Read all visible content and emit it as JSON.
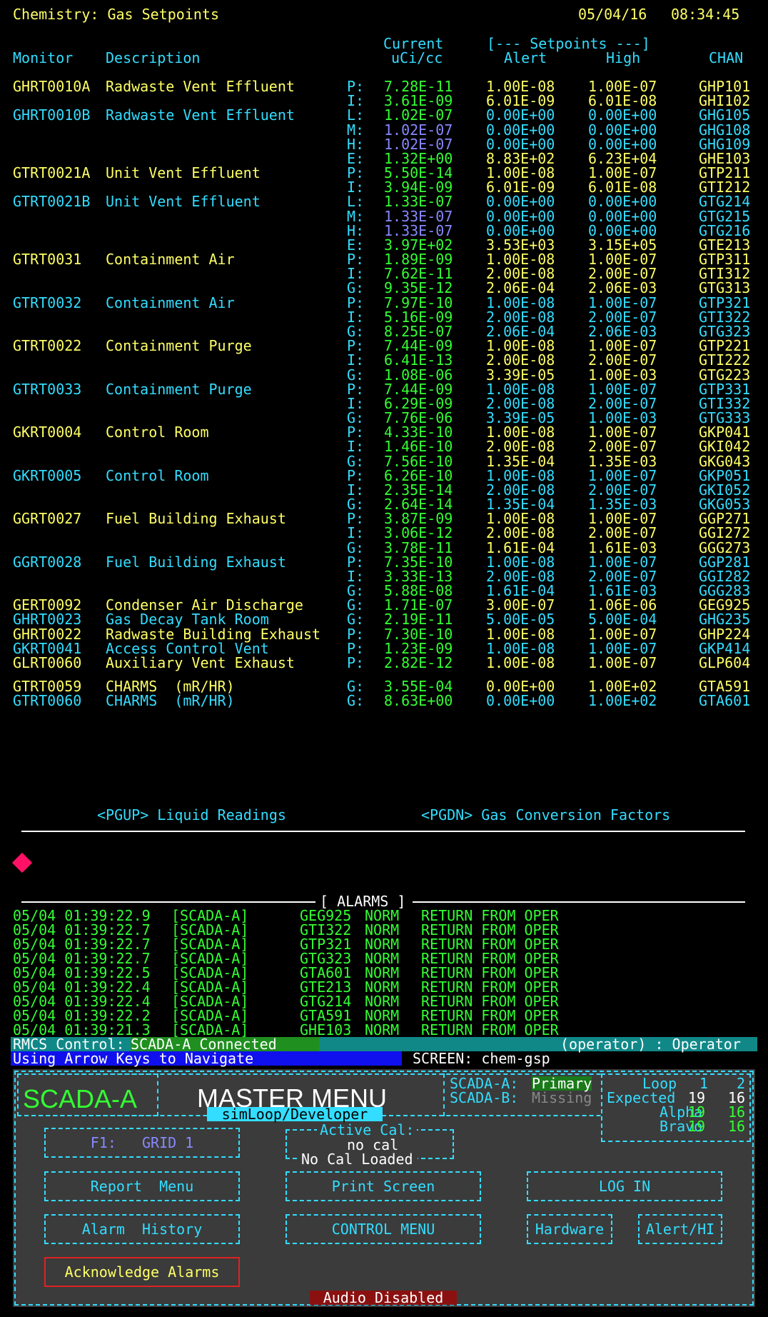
{
  "header": {
    "title": "Chemistry: Gas Setpoints",
    "date": "05/04/16",
    "time": "08:34:45"
  },
  "columns": {
    "current_top": "Current",
    "current_unit": "uCi/cc",
    "setpoints_group": "[--- Setpoints ---]",
    "monitor": "Monitor",
    "description": "Description",
    "alert": "Alert",
    "high": "High",
    "chan": "CHAN"
  },
  "rows": [
    {
      "monitor": "GHRT0010A",
      "desc": "Radwaste Vent Effluent",
      "t": "P:",
      "cur": "7.28E-11",
      "alert": "1.00E-08",
      "high": "1.00E-07",
      "chan": "GHP101",
      "mc": "y",
      "vc": "g",
      "sc": "y"
    },
    {
      "monitor": "",
      "desc": "",
      "t": "I:",
      "cur": "3.61E-09",
      "alert": "6.01E-09",
      "high": "6.01E-08",
      "chan": "GHI102",
      "mc": "y",
      "vc": "g",
      "sc": "y"
    },
    {
      "monitor": "GHRT0010B",
      "desc": "Radwaste Vent Effluent",
      "t": "L:",
      "cur": "1.02E-07",
      "alert": "0.00E+00",
      "high": "0.00E+00",
      "chan": "GHG105",
      "mc": "c",
      "vc": "g",
      "sc": "c"
    },
    {
      "monitor": "",
      "desc": "",
      "t": "M:",
      "cur": "1.02E-07",
      "alert": "0.00E+00",
      "high": "0.00E+00",
      "chan": "GHG108",
      "mc": "c",
      "vc": "b",
      "sc": "c"
    },
    {
      "monitor": "",
      "desc": "",
      "t": "H:",
      "cur": "1.02E-07",
      "alert": "0.00E+00",
      "high": "0.00E+00",
      "chan": "GHG109",
      "mc": "c",
      "vc": "b",
      "sc": "c"
    },
    {
      "monitor": "",
      "desc": "",
      "t": "E:",
      "cur": "1.32E+00",
      "alert": "8.83E+02",
      "high": "6.23E+04",
      "chan": "GHE103",
      "mc": "c",
      "vc": "g",
      "sc": "y"
    },
    {
      "monitor": "GTRT0021A",
      "desc": "Unit Vent Effluent",
      "t": "P:",
      "cur": "5.50E-14",
      "alert": "1.00E-08",
      "high": "1.00E-07",
      "chan": "GTP211",
      "mc": "y",
      "vc": "g",
      "sc": "y"
    },
    {
      "monitor": "",
      "desc": "",
      "t": "I:",
      "cur": "3.94E-09",
      "alert": "6.01E-09",
      "high": "6.01E-08",
      "chan": "GTI212",
      "mc": "y",
      "vc": "g",
      "sc": "y"
    },
    {
      "monitor": "GTRT0021B",
      "desc": "Unit Vent Effluent",
      "t": "L:",
      "cur": "1.33E-07",
      "alert": "0.00E+00",
      "high": "0.00E+00",
      "chan": "GTG214",
      "mc": "c",
      "vc": "g",
      "sc": "c"
    },
    {
      "monitor": "",
      "desc": "",
      "t": "M:",
      "cur": "1.33E-07",
      "alert": "0.00E+00",
      "high": "0.00E+00",
      "chan": "GTG215",
      "mc": "c",
      "vc": "b",
      "sc": "c"
    },
    {
      "monitor": "",
      "desc": "",
      "t": "H:",
      "cur": "1.33E-07",
      "alert": "0.00E+00",
      "high": "0.00E+00",
      "chan": "GTG216",
      "mc": "c",
      "vc": "b",
      "sc": "c"
    },
    {
      "monitor": "",
      "desc": "",
      "t": "E:",
      "cur": "3.97E+02",
      "alert": "3.53E+03",
      "high": "3.15E+05",
      "chan": "GTE213",
      "mc": "c",
      "vc": "g",
      "sc": "y"
    },
    {
      "monitor": "GTRT0031",
      "desc": "Containment Air",
      "t": "P:",
      "cur": "1.89E-09",
      "alert": "1.00E-08",
      "high": "1.00E-07",
      "chan": "GTP311",
      "mc": "y",
      "vc": "g",
      "sc": "y"
    },
    {
      "monitor": "",
      "desc": "",
      "t": "I:",
      "cur": "7.62E-11",
      "alert": "2.00E-08",
      "high": "2.00E-07",
      "chan": "GTI312",
      "mc": "y",
      "vc": "g",
      "sc": "y"
    },
    {
      "monitor": "",
      "desc": "",
      "t": "G:",
      "cur": "9.35E-12",
      "alert": "2.06E-04",
      "high": "2.06E-03",
      "chan": "GTG313",
      "mc": "y",
      "vc": "g",
      "sc": "y"
    },
    {
      "monitor": "GTRT0032",
      "desc": "Containment Air",
      "t": "P:",
      "cur": "7.97E-10",
      "alert": "1.00E-08",
      "high": "1.00E-07",
      "chan": "GTP321",
      "mc": "c",
      "vc": "g",
      "sc": "c"
    },
    {
      "monitor": "",
      "desc": "",
      "t": "I:",
      "cur": "5.16E-09",
      "alert": "2.00E-08",
      "high": "2.00E-07",
      "chan": "GTI322",
      "mc": "c",
      "vc": "g",
      "sc": "c"
    },
    {
      "monitor": "",
      "desc": "",
      "t": "G:",
      "cur": "8.25E-07",
      "alert": "2.06E-04",
      "high": "2.06E-03",
      "chan": "GTG323",
      "mc": "c",
      "vc": "g",
      "sc": "c"
    },
    {
      "monitor": "GTRT0022",
      "desc": "Containment Purge",
      "t": "P:",
      "cur": "7.44E-09",
      "alert": "1.00E-08",
      "high": "1.00E-07",
      "chan": "GTP221",
      "mc": "y",
      "vc": "g",
      "sc": "y"
    },
    {
      "monitor": "",
      "desc": "",
      "t": "I:",
      "cur": "6.41E-13",
      "alert": "2.00E-08",
      "high": "2.00E-07",
      "chan": "GTI222",
      "mc": "y",
      "vc": "g",
      "sc": "y"
    },
    {
      "monitor": "",
      "desc": "",
      "t": "G:",
      "cur": "1.08E-06",
      "alert": "3.39E-05",
      "high": "1.00E-03",
      "chan": "GTG223",
      "mc": "y",
      "vc": "g",
      "sc": "y"
    },
    {
      "monitor": "GTRT0033",
      "desc": "Containment Purge",
      "t": "P:",
      "cur": "7.44E-09",
      "alert": "1.00E-08",
      "high": "1.00E-07",
      "chan": "GTP331",
      "mc": "c",
      "vc": "g",
      "sc": "c"
    },
    {
      "monitor": "",
      "desc": "",
      "t": "I:",
      "cur": "6.29E-09",
      "alert": "2.00E-08",
      "high": "2.00E-07",
      "chan": "GTI332",
      "mc": "c",
      "vc": "g",
      "sc": "c"
    },
    {
      "monitor": "",
      "desc": "",
      "t": "G:",
      "cur": "7.76E-06",
      "alert": "3.39E-05",
      "high": "1.00E-03",
      "chan": "GTG333",
      "mc": "c",
      "vc": "g",
      "sc": "c"
    },
    {
      "monitor": "GKRT0004",
      "desc": "Control Room",
      "t": "P:",
      "cur": "4.33E-10",
      "alert": "1.00E-08",
      "high": "1.00E-07",
      "chan": "GKP041",
      "mc": "y",
      "vc": "g",
      "sc": "y"
    },
    {
      "monitor": "",
      "desc": "",
      "t": "I:",
      "cur": "1.46E-10",
      "alert": "2.00E-08",
      "high": "2.00E-07",
      "chan": "GKI042",
      "mc": "y",
      "vc": "g",
      "sc": "y"
    },
    {
      "monitor": "",
      "desc": "",
      "t": "G:",
      "cur": "7.56E-10",
      "alert": "1.35E-04",
      "high": "1.35E-03",
      "chan": "GKG043",
      "mc": "y",
      "vc": "g",
      "sc": "y"
    },
    {
      "monitor": "GKRT0005",
      "desc": "Control Room",
      "t": "P:",
      "cur": "6.26E-10",
      "alert": "1.00E-08",
      "high": "1.00E-07",
      "chan": "GKP051",
      "mc": "c",
      "vc": "g",
      "sc": "c"
    },
    {
      "monitor": "",
      "desc": "",
      "t": "I:",
      "cur": "2.35E-14",
      "alert": "2.00E-08",
      "high": "2.00E-07",
      "chan": "GKI052",
      "mc": "c",
      "vc": "g",
      "sc": "c"
    },
    {
      "monitor": "",
      "desc": "",
      "t": "G:",
      "cur": "2.64E-14",
      "alert": "1.35E-04",
      "high": "1.35E-03",
      "chan": "GKG053",
      "mc": "c",
      "vc": "g",
      "sc": "c"
    },
    {
      "monitor": "GGRT0027",
      "desc": "Fuel Building Exhaust",
      "t": "P:",
      "cur": "3.87E-09",
      "alert": "1.00E-08",
      "high": "1.00E-07",
      "chan": "GGP271",
      "mc": "y",
      "vc": "g",
      "sc": "y"
    },
    {
      "monitor": "",
      "desc": "",
      "t": "I:",
      "cur": "3.06E-12",
      "alert": "2.00E-08",
      "high": "2.00E-07",
      "chan": "GGI272",
      "mc": "y",
      "vc": "g",
      "sc": "y"
    },
    {
      "monitor": "",
      "desc": "",
      "t": "G:",
      "cur": "3.78E-11",
      "alert": "1.61E-04",
      "high": "1.61E-03",
      "chan": "GGG273",
      "mc": "y",
      "vc": "g",
      "sc": "y"
    },
    {
      "monitor": "GGRT0028",
      "desc": "Fuel Building Exhaust",
      "t": "P:",
      "cur": "7.35E-10",
      "alert": "1.00E-08",
      "high": "1.00E-07",
      "chan": "GGP281",
      "mc": "c",
      "vc": "g",
      "sc": "c"
    },
    {
      "monitor": "",
      "desc": "",
      "t": "I:",
      "cur": "3.33E-13",
      "alert": "2.00E-08",
      "high": "2.00E-07",
      "chan": "GGI282",
      "mc": "c",
      "vc": "g",
      "sc": "c"
    },
    {
      "monitor": "",
      "desc": "",
      "t": "G:",
      "cur": "5.88E-08",
      "alert": "1.61E-04",
      "high": "1.61E-03",
      "chan": "GGG283",
      "mc": "c",
      "vc": "g",
      "sc": "c"
    },
    {
      "monitor": "GERT0092",
      "desc": "Condenser Air Discharge",
      "t": "G:",
      "cur": "1.71E-07",
      "alert": "3.00E-07",
      "high": "1.06E-06",
      "chan": "GEG925",
      "mc": "y",
      "vc": "g",
      "sc": "y"
    },
    {
      "monitor": "GHRT0023",
      "desc": "Gas Decay Tank Room",
      "t": "G:",
      "cur": "2.19E-11",
      "alert": "5.00E-05",
      "high": "5.00E-04",
      "chan": "GHG235",
      "mc": "c",
      "vc": "g",
      "sc": "c"
    },
    {
      "monitor": "GHRT0022",
      "desc": "Radwaste Building Exhaust",
      "t": "P:",
      "cur": "7.30E-10",
      "alert": "1.00E-08",
      "high": "1.00E-07",
      "chan": "GHP224",
      "mc": "y",
      "vc": "g",
      "sc": "y"
    },
    {
      "monitor": "GKRT0041",
      "desc": "Access Control Vent",
      "t": "P:",
      "cur": "1.23E-09",
      "alert": "1.00E-08",
      "high": "1.00E-07",
      "chan": "GKP414",
      "mc": "c",
      "vc": "g",
      "sc": "c"
    },
    {
      "monitor": "GLRT0060",
      "desc": "Auxiliary Vent Exhaust",
      "t": "P:",
      "cur": "2.82E-12",
      "alert": "1.00E-08",
      "high": "1.00E-07",
      "chan": "GLP604",
      "mc": "y",
      "vc": "g",
      "sc": "y"
    }
  ],
  "charms_rows": [
    {
      "monitor": "GTRT0059",
      "desc": "CHARMS  (mR/HR)",
      "t": "G:",
      "cur": "3.55E-04",
      "alert": "0.00E+00",
      "high": "1.00E+02",
      "chan": "GTA591",
      "mc": "y",
      "vc": "g",
      "sc": "y"
    },
    {
      "monitor": "GTRT0060",
      "desc": "CHARMS  (mR/HR)",
      "t": "G:",
      "cur": "8.63E+00",
      "alert": "0.00E+00",
      "high": "1.00E+02",
      "chan": "GTA601",
      "mc": "c",
      "vc": "g",
      "sc": "c"
    }
  ],
  "nav": {
    "pgup": "<PGUP> Liquid Readings",
    "pgdn": "<PGDN> Gas Conversion Factors"
  },
  "alarms_title": "[ ALARMS ]",
  "alarms": [
    {
      "ts": "05/04 01:39:22.9",
      "src": "[SCADA-A]",
      "chan": "GEG925",
      "state": "NORM",
      "msg": "RETURN FROM OPER"
    },
    {
      "ts": "05/04 01:39:22.7",
      "src": "[SCADA-A]",
      "chan": "GTI322",
      "state": "NORM",
      "msg": "RETURN FROM OPER"
    },
    {
      "ts": "05/04 01:39:22.7",
      "src": "[SCADA-A]",
      "chan": "GTP321",
      "state": "NORM",
      "msg": "RETURN FROM OPER"
    },
    {
      "ts": "05/04 01:39:22.7",
      "src": "[SCADA-A]",
      "chan": "GTG323",
      "state": "NORM",
      "msg": "RETURN FROM OPER"
    },
    {
      "ts": "05/04 01:39:22.5",
      "src": "[SCADA-A]",
      "chan": "GTA601",
      "state": "NORM",
      "msg": "RETURN FROM OPER"
    },
    {
      "ts": "05/04 01:39:22.4",
      "src": "[SCADA-A]",
      "chan": "GTE213",
      "state": "NORM",
      "msg": "RETURN FROM OPER"
    },
    {
      "ts": "05/04 01:39:22.4",
      "src": "[SCADA-A]",
      "chan": "GTG214",
      "state": "NORM",
      "msg": "RETURN FROM OPER"
    },
    {
      "ts": "05/04 01:39:22.2",
      "src": "[SCADA-A]",
      "chan": "GTA591",
      "state": "NORM",
      "msg": "RETURN FROM OPER"
    },
    {
      "ts": "05/04 01:39:21.3",
      "src": "[SCADA-A]",
      "chan": "GHE103",
      "state": "NORM",
      "msg": "RETURN FROM OPER"
    }
  ],
  "status": {
    "rmcs_label": "RMCS Control:",
    "rmcs_value": "SCADA-A Connected",
    "operator": "(operator) : Operator",
    "hint": "Using Arrow Keys to Navigate",
    "screen": "SCREEN: chem-gsp"
  },
  "menu": {
    "system": "SCADA-A",
    "title": "MASTER MENU",
    "subtitle": "simLoop/Developer",
    "scada_a_label": "SCADA-A:",
    "scada_a_value": "Primary",
    "scada_b_label": "SCADA-B:",
    "scada_b_value": "Missing",
    "loop_label": "Loop",
    "loop_1": "1",
    "loop_2": "2",
    "expected_label": "Expected",
    "expected_1": "19",
    "expected_2": "16",
    "alpha_label": "Alpha",
    "alpha_1": "19",
    "alpha_2": "16",
    "bravo_label": "Bravo",
    "bravo_1": "19",
    "bravo_2": "16",
    "f1_button": "F1:   GRID 1",
    "active_cal_label": "Active Cal:",
    "active_cal_value": "no cal",
    "cal_status": "No Cal Loaded",
    "report_menu": "Report  Menu",
    "print_screen": "Print Screen",
    "log_in": "LOG IN",
    "alarm_history": "Alarm  History",
    "control_menu": "CONTROL MENU",
    "hardware": "Hardware",
    "alert_hi": "Alert/HI",
    "ack_alarms": "Acknowledge Alarms",
    "audio": "Audio Disabled"
  },
  "colors": {
    "yellow": "#ffff66",
    "cyan": "#33ddff",
    "green": "#33ff33",
    "blue": "#8888ff",
    "alert_marker": "#ff1166"
  }
}
